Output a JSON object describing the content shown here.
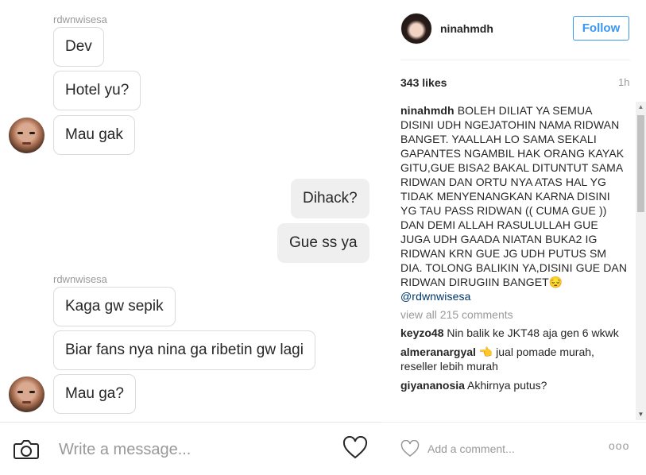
{
  "chat": {
    "groups": [
      {
        "sender": "rdwnwisesa",
        "messages": [
          "Dev",
          "Hotel yu?",
          "Mau gak"
        ]
      },
      {
        "outgoing": [
          "Dihack?",
          "Gue ss ya"
        ]
      },
      {
        "sender": "rdwnwisesa",
        "messages": [
          "Kaga gw sepik",
          "Biar fans nya nina ga ribetin gw lagi",
          "Mau ga?"
        ]
      }
    ],
    "composer": {
      "placeholder": "Write a message...",
      "camera_icon": "camera-icon",
      "heart_icon": "heart-outline-icon"
    }
  },
  "post": {
    "author": "ninahmdh",
    "follow_label": "Follow",
    "likes": "343 likes",
    "time_ago": "1h",
    "caption": {
      "user": "ninahmdh",
      "text": "BOLEH DILIAT YA SEMUA DISINI UDH NGEJATOHIN NAMA RIDWAN BANGET. YAALLAH LO SAMA SEKALI GAPANTES NGAMBIL HAK ORANG KAYAK GITU,GUE BISA2 BAKAL DITUNTUT SAMA RIDWAN DAN ORTU NYA ATAS HAL YG TIDAK MENYENANGKAN KARNA DISINI YG TAU PASS RIDWAN (( CUMA GUE )) DAN DEMI ALLAH RASULULLAH GUE JUGA UDH GAADA NIATAN BUKA2 IG RIDWAN KRN GUE JG UDH PUTUS SM DIA. TOLONG BALIKIN YA,DISINI GUE DAN RIDWAN DIRUGIIN BANGET😔",
      "mention": "@rdwnwisesa"
    },
    "view_all": "view all 215 comments",
    "comments": [
      {
        "user": "keyzo48",
        "text": "Nin balik ke JKT48 aja gen 6 wkwk"
      },
      {
        "user": "almeranargyal",
        "text": "👈 jual pomade murah, reseller lebih murah"
      },
      {
        "user": "giyananosia",
        "text": "Akhirnya putus?"
      }
    ],
    "footer": {
      "comment_placeholder": "Add a comment...",
      "more_label": "ooo",
      "like_icon": "heart-outline-icon"
    }
  },
  "colors": {
    "accent": "#3897f0",
    "mention": "#003569",
    "muted": "#999999",
    "outgoing_bubble": "#efefef",
    "border": "#dbdbdb"
  }
}
